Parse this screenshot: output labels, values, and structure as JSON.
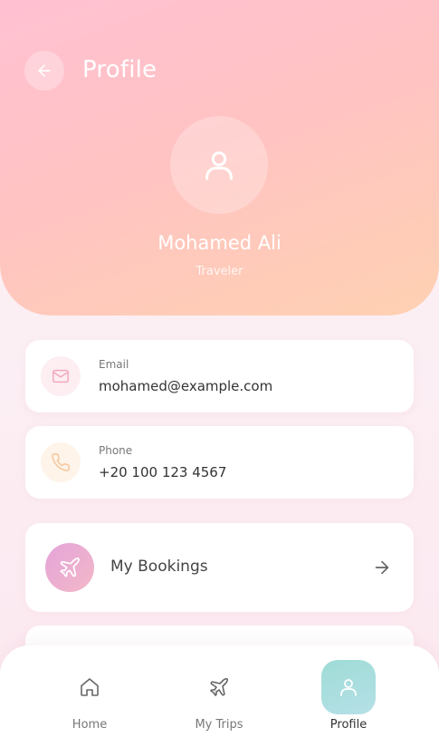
{
  "header": {
    "title": "Profile",
    "back_icon": "arrow-left-icon",
    "user": {
      "name": "Mohamed Ali",
      "role": "Traveler",
      "avatar_icon": "user-icon"
    }
  },
  "contact": [
    {
      "label": "Email",
      "value": "mohamed@example.com",
      "icon": "mail-icon",
      "accent": "#f3a9bf"
    },
    {
      "label": "Phone",
      "value": "+20 100 123 4567",
      "icon": "phone-icon",
      "accent": "#f5c59a"
    }
  ],
  "menu": {
    "items": [
      {
        "label": "My Bookings",
        "icon": "airplane-icon",
        "trailing_icon": "arrow-right-icon"
      }
    ]
  },
  "bottom_nav": {
    "items": [
      {
        "label": "Home",
        "icon": "home-icon",
        "active": false
      },
      {
        "label": "My Trips",
        "icon": "airplane-icon",
        "active": false
      },
      {
        "label": "Profile",
        "icon": "user-icon",
        "active": true
      }
    ]
  },
  "colors": {
    "header_gradient_start": "#ffc1d2",
    "header_gradient_end": "#ffd1b2",
    "active_nav": "#9fdcd6",
    "booking_icon_gradient": "#e4a4d9"
  }
}
